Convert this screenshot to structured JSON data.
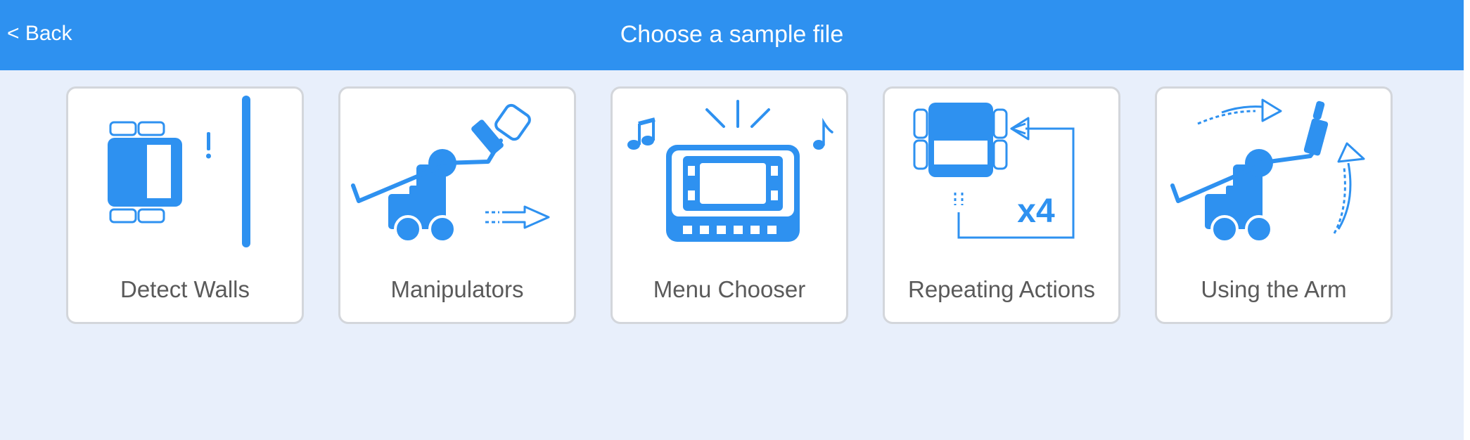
{
  "header": {
    "back_label": "< Back",
    "title": "Choose a sample file",
    "background_color": "#2e91f0"
  },
  "samples": [
    {
      "label": "Detect Walls",
      "icon": "detect-walls-icon"
    },
    {
      "label": "Manipulators",
      "icon": "manipulators-icon"
    },
    {
      "label": "Menu Chooser",
      "icon": "menu-chooser-icon"
    },
    {
      "label": "Repeating Actions",
      "icon": "repeating-actions-icon"
    },
    {
      "label": "Using the Arm",
      "icon": "using-the-arm-icon"
    }
  ],
  "colors": {
    "icon_blue": "#2e91f0",
    "page_background": "#e8effb",
    "card_border": "#d3d6db",
    "label_text": "#5a5a5a"
  }
}
